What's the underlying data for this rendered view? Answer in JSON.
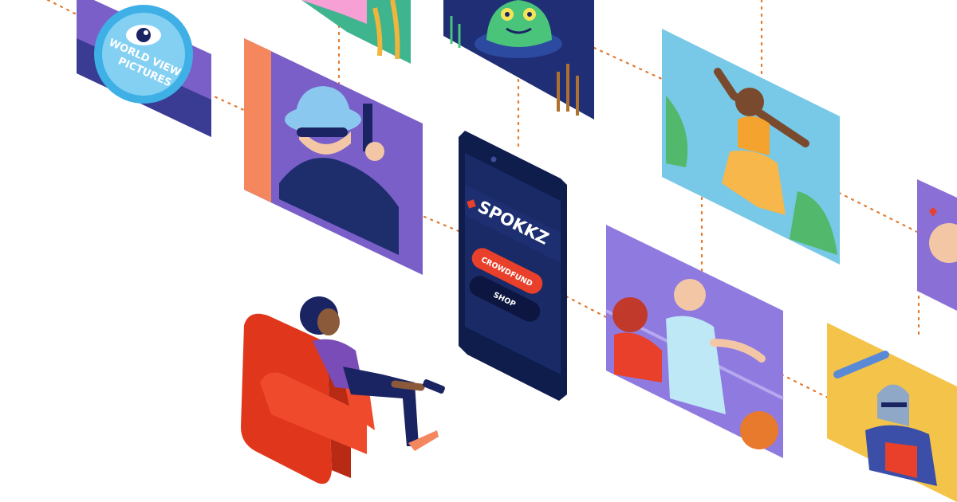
{
  "logo": {
    "name": "SPOKKZ",
    "diamond_color": "#e8402a"
  },
  "buttons": {
    "crowdfund_label": "CROWDFUND",
    "shop_label": "SHOP"
  },
  "studio_badge": {
    "line1": "WORLD VIEW",
    "line2": "PICTURES"
  },
  "colors": {
    "phone_body": "#0f1d4d",
    "phone_screen": "#1a2a66",
    "crowdfund_button": "#e8402a",
    "shop_button": "#0c1640",
    "connector": "#e27a2e",
    "armchair": "#e0371c"
  },
  "panels": [
    {
      "name": "panel-world-view-pictures",
      "icon": "eye-icon"
    },
    {
      "name": "panel-spy",
      "icon": "spy-with-gun"
    },
    {
      "name": "panel-flowers",
      "icon": "flower-wheat"
    },
    {
      "name": "panel-swamp-monster",
      "icon": "monster"
    },
    {
      "name": "panel-dancer",
      "icon": "dancer"
    },
    {
      "name": "panel-basketball",
      "icon": "basketball-players"
    },
    {
      "name": "panel-knight",
      "icon": "knight"
    },
    {
      "name": "panel-love",
      "icon": "person-with-hearts"
    }
  ]
}
